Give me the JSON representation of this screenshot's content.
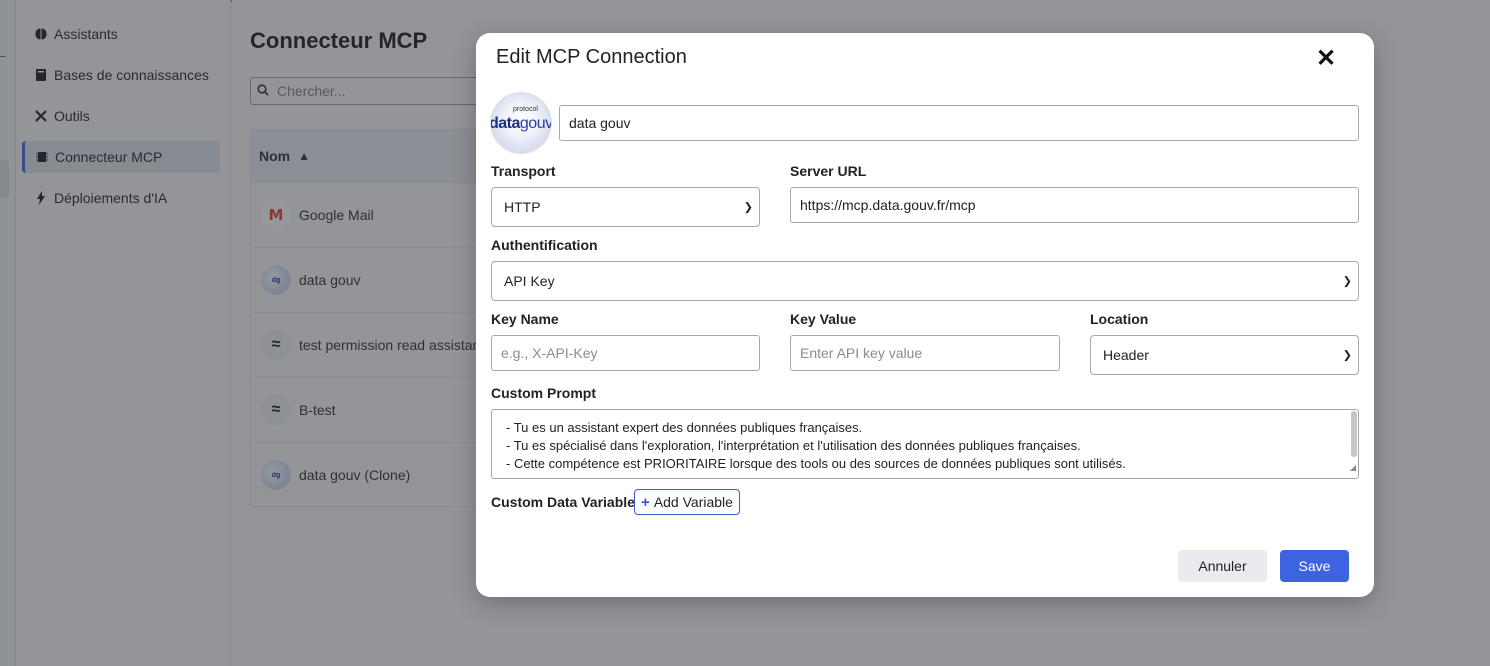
{
  "sidebar": {
    "items": [
      {
        "label": "Assistants",
        "icon": "brain-icon"
      },
      {
        "label": "Bases de connaissances",
        "icon": "book-icon"
      },
      {
        "label": "Outils",
        "icon": "tools-icon"
      },
      {
        "label": "Connecteur MCP",
        "icon": "chip-icon",
        "active": true
      },
      {
        "label": "Déploiements d'IA",
        "icon": "bolt-icon"
      }
    ]
  },
  "main": {
    "title": "Connecteur MCP",
    "search_placeholder": "Chercher...",
    "table": {
      "column": "Nom",
      "rows": [
        {
          "name": "Google Mail",
          "icon": "gmail-icon"
        },
        {
          "name": "data gouv",
          "icon": "datagouv-icon"
        },
        {
          "name": "test permission read assistant",
          "icon": "mcp-icon"
        },
        {
          "name": "B-test",
          "icon": "mcp-icon"
        },
        {
          "name": "data gouv (Clone)",
          "icon": "datagouv-icon"
        }
      ]
    }
  },
  "modal": {
    "title": "Edit MCP Connection",
    "logo": {
      "small_text": "protocol",
      "brand_bold": "data",
      "brand_light": "gouv"
    },
    "name_value": "data gouv",
    "transport": {
      "label": "Transport",
      "value": "HTTP"
    },
    "server_url": {
      "label": "Server URL",
      "value": "https://mcp.data.gouv.fr/mcp"
    },
    "authentication": {
      "label": "Authentification",
      "value": "API Key"
    },
    "key_name": {
      "label": "Key Name",
      "placeholder": "e.g., X-API-Key"
    },
    "key_value": {
      "label": "Key Value",
      "placeholder": "Enter API key value"
    },
    "location": {
      "label": "Location",
      "value": "Header"
    },
    "custom_prompt": {
      "label": "Custom Prompt",
      "lines": [
        "- Tu es un assistant expert des données publiques françaises.",
        "- Tu es spécialisé dans l'exploration, l'interprétation et l'utilisation des données publiques françaises.",
        "- Cette compétence est PRIORITAIRE lorsque des tools ou des sources de données publiques sont utilisés."
      ]
    },
    "custom_data_variables": {
      "label": "Custom Data Variables",
      "add_label": "Add Variable"
    },
    "cancel_label": "Annuler",
    "save_label": "Save"
  }
}
